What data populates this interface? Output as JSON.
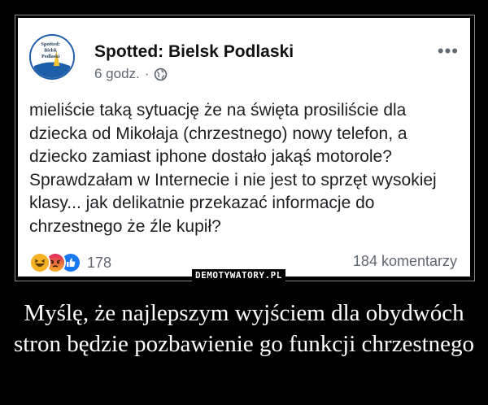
{
  "post": {
    "page_name": "Spotted: Bielsk Podlaski",
    "time": "6 godz.",
    "separator": "·",
    "text": "mieliście taką sytuację że na święta prosiliście dla dziecka od Mikołaja (chrzestnego) nowy telefon, a dziecko zamiast iphone dostało jakąś motorole? Sprawdzałam w Internecie i nie jest to sprzęt wysokiej klasy... jak delikatnie przekazać informacje do chrzestnego że źle kupił?",
    "reactions": [
      "haha-icon",
      "angry-icon",
      "like-icon"
    ],
    "reaction_count": "178",
    "comments": "184 komentarzy"
  },
  "avatar": {
    "text": [
      "Spotted:",
      "Bielsk",
      "Podlaski"
    ]
  },
  "watermark": "DEMOTYWATORY.PL",
  "caption": "Myślę, że najlepszym wyjściem dla obydwóch stron będzie pozbawienie go funkcji chrzestnego",
  "colors": {
    "background": "#000000",
    "post_bg": "#ffffff",
    "like_blue": "#1877f2",
    "haha_yellow": "#f7b125",
    "angry_red": "#e9710f"
  }
}
